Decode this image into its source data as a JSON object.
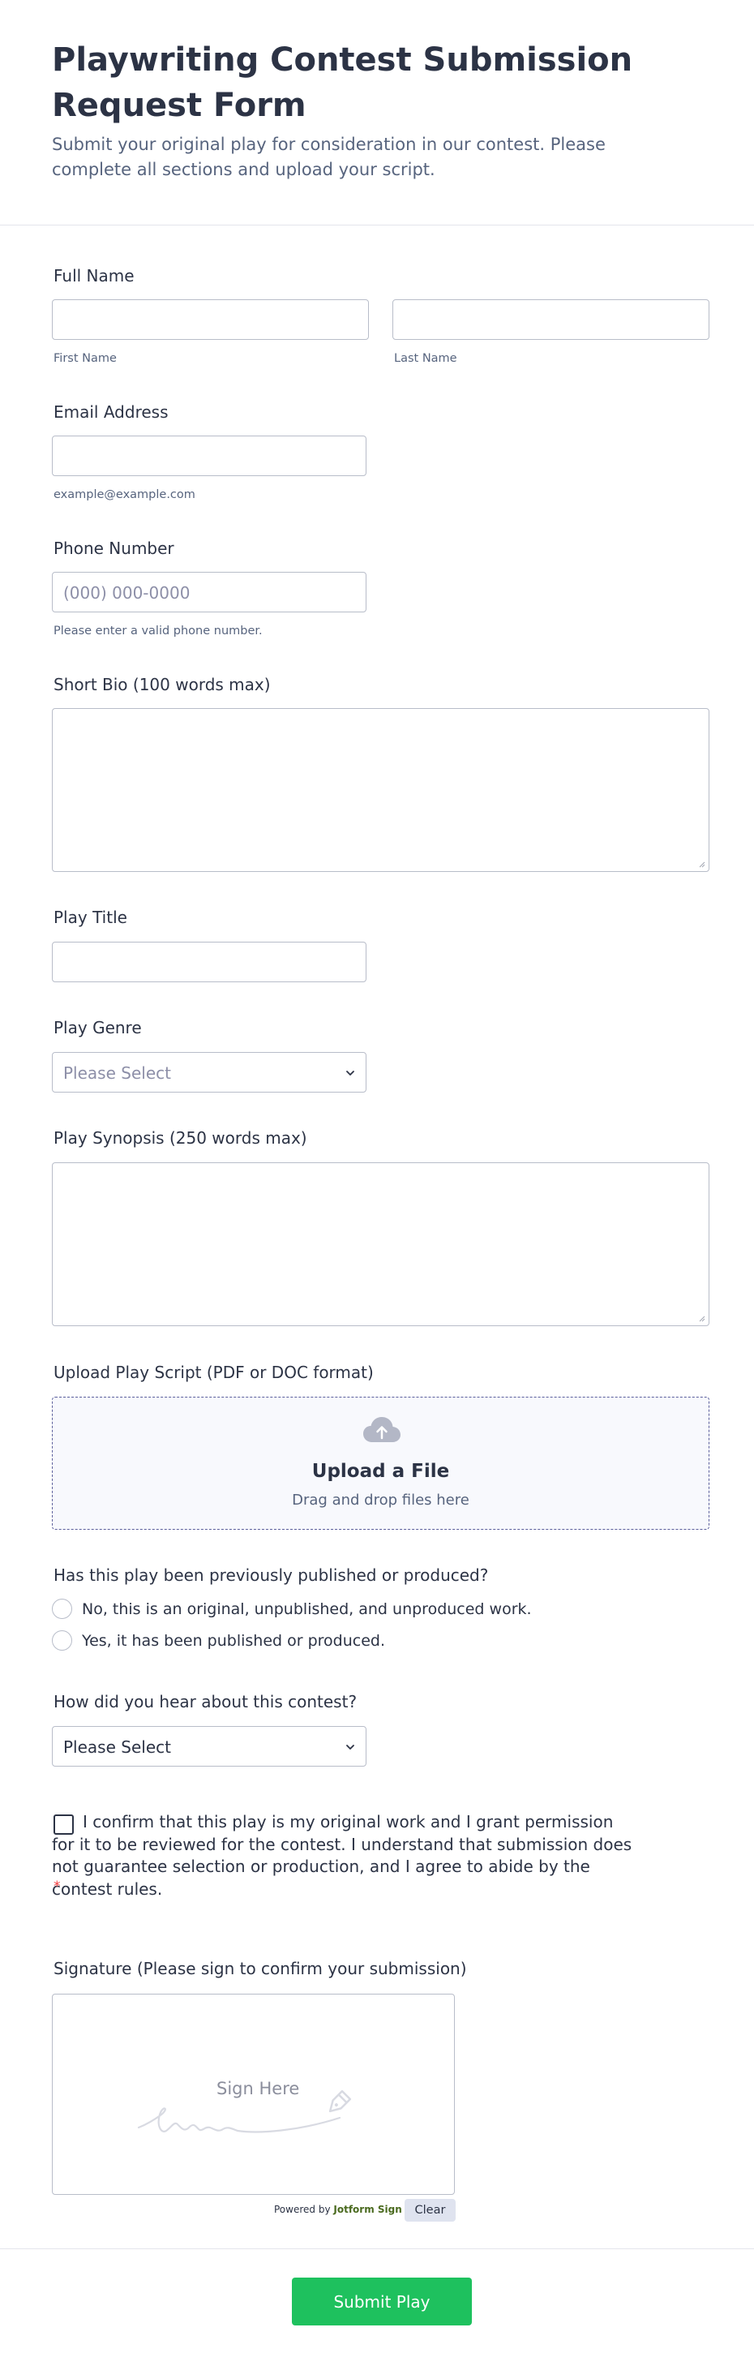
{
  "header": {
    "title": "Playwriting Contest Submission Request Form",
    "subtitle": "Submit your original play for consideration in our contest. Please complete all sections and upload your script."
  },
  "full_name": {
    "label": "Full Name",
    "first_sublabel": "First Name",
    "last_sublabel": "Last Name"
  },
  "email": {
    "label": "Email Address",
    "sublabel": "example@example.com"
  },
  "phone": {
    "label": "Phone Number",
    "placeholder": "(000) 000-0000",
    "sublabel": "Please enter a valid phone number."
  },
  "bio": {
    "label": "Short Bio (100 words max)"
  },
  "play_title": {
    "label": "Play Title"
  },
  "genre": {
    "label": "Play Genre",
    "placeholder": "Please Select"
  },
  "synopsis": {
    "label": "Play Synopsis (250 words max)"
  },
  "upload": {
    "label": "Upload Play Script (PDF or DOC format)",
    "title": "Upload a File",
    "subtitle": "Drag and drop files here",
    "icon": "cloud-upload-icon"
  },
  "published": {
    "label": "Has this play been previously published or produced?",
    "options": [
      "No, this is an original, unpublished, and unproduced work.",
      "Yes, it has been published or produced."
    ]
  },
  "referral": {
    "label": "How did you hear about this contest?",
    "value": "Please Select"
  },
  "consent": {
    "text": "I confirm that this play is my original work and I grant permission for it to be reviewed for the contest. I understand that submission does not guarantee selection or production, and I agree to abide by the contest rules.",
    "required_mark": "*"
  },
  "signature": {
    "label": "Signature (Please sign to confirm your submission)",
    "placeholder": "Sign Here",
    "powered_by": "Powered by",
    "brand": "Jotform Sign",
    "clear_label": "Clear"
  },
  "submit": {
    "label": "Submit Play",
    "color": "#1ec15e"
  },
  "colors": {
    "text": "#2c3345",
    "muted": "#57647e",
    "border": "#b8bdc9",
    "required": "#f23a3c"
  }
}
